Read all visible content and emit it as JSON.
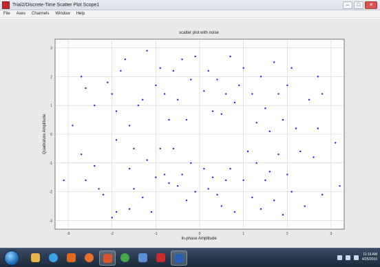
{
  "window": {
    "title": "Trial2/Discrete-Time Scatter Plot Scope1",
    "controls": {
      "minimize": "–",
      "maximize": "□",
      "close": "✕"
    }
  },
  "menu": [
    "File",
    "Axes",
    "Channels",
    "Window",
    "Help"
  ],
  "colors": {
    "marker": "#2020e0",
    "axes_background": "#ffffff",
    "figure_background": "#e9e9e9",
    "taskbar": "#1f2a3b"
  },
  "taskbar": {
    "apps": [
      {
        "name": "start-orb"
      },
      {
        "name": "file-explorer-icon",
        "color": "#e6b64a"
      },
      {
        "name": "internet-explorer-icon",
        "color": "#3aa3e6"
      },
      {
        "name": "media-player-icon",
        "color": "#e06a1f"
      },
      {
        "name": "firefox-icon",
        "color": "#e8702a"
      },
      {
        "name": "matlab-icon",
        "color": "#d9532c"
      },
      {
        "name": "chrome-icon",
        "color": "#47a64a"
      },
      {
        "name": "settings-icon",
        "color": "#5a8fd1"
      },
      {
        "name": "pdf-reader-icon",
        "color": "#cc2a2a"
      },
      {
        "name": "word-icon",
        "color": "#2b5fb4"
      }
    ],
    "clock": {
      "time": "11:19 AM",
      "date": "4/25/2016"
    }
  },
  "chart_data": {
    "type": "scatter",
    "title": "scatter plot with noise",
    "xlabel": "In-phase Amplitude",
    "ylabel": "Quadrature Amplitude",
    "xlim": [
      -3.3,
      3.3
    ],
    "ylim": [
      -3.3,
      3.3
    ],
    "xticks": [
      -3,
      -2,
      -1,
      0,
      1,
      2,
      3
    ],
    "yticks": [
      -3,
      -2,
      -1,
      0,
      1,
      2,
      3
    ],
    "grid": true,
    "marker_color": "#2020e0",
    "series": [
      {
        "points": [
          [
            -2.9,
            0.3
          ],
          [
            -2.7,
            2.0
          ],
          [
            -2.6,
            1.6
          ],
          [
            -2.4,
            1.0
          ],
          [
            -2.7,
            -0.7
          ],
          [
            -2.6,
            -1.6
          ],
          [
            -2.4,
            -1.1
          ],
          [
            -2.3,
            -1.9
          ],
          [
            -2.2,
            -2.1
          ],
          [
            -2.1,
            1.8
          ],
          [
            -2.0,
            1.4
          ],
          [
            -1.9,
            0.8
          ],
          [
            -1.9,
            -0.2
          ],
          [
            -1.9,
            -2.7
          ],
          [
            -2.0,
            -2.9
          ],
          [
            -1.8,
            2.2
          ],
          [
            -1.7,
            2.6
          ],
          [
            -1.6,
            0.3
          ],
          [
            -1.6,
            -1.2
          ],
          [
            -1.6,
            -2.6
          ],
          [
            -1.5,
            -1.9
          ],
          [
            -1.4,
            1.0
          ],
          [
            -1.5,
            -0.5
          ],
          [
            -1.3,
            1.2
          ],
          [
            -1.3,
            -2.2
          ],
          [
            -1.2,
            2.9
          ],
          [
            -1.2,
            -0.9
          ],
          [
            -1.1,
            -2.7
          ],
          [
            -1.0,
            -1.5
          ],
          [
            -1.0,
            1.7
          ],
          [
            -0.9,
            -0.5
          ],
          [
            -0.9,
            2.3
          ],
          [
            -0.8,
            -1.4
          ],
          [
            -0.8,
            1.4
          ],
          [
            -0.7,
            0.5
          ],
          [
            -0.7,
            -1.7
          ],
          [
            -0.6,
            -0.5
          ],
          [
            -0.6,
            2.2
          ],
          [
            -0.5,
            1.2
          ],
          [
            -0.5,
            -1.8
          ],
          [
            -0.4,
            2.6
          ],
          [
            -0.4,
            -1.4
          ],
          [
            -0.3,
            0.5
          ],
          [
            -0.3,
            -2.3
          ],
          [
            -0.2,
            1.9
          ],
          [
            -0.2,
            -1.0
          ],
          [
            -0.1,
            2.7
          ],
          [
            -0.1,
            -2.0
          ],
          [
            0.1,
            1.5
          ],
          [
            0.1,
            -1.2
          ],
          [
            0.2,
            2.2
          ],
          [
            0.2,
            -1.9
          ],
          [
            0.3,
            0.8
          ],
          [
            0.3,
            -1.5
          ],
          [
            0.4,
            1.9
          ],
          [
            0.4,
            -2.1
          ],
          [
            0.5,
            0.7
          ],
          [
            0.5,
            -2.5
          ],
          [
            0.6,
            1.4
          ],
          [
            0.6,
            -1.6
          ],
          [
            0.7,
            2.7
          ],
          [
            0.7,
            -1.2
          ],
          [
            0.8,
            1.1
          ],
          [
            0.8,
            -2.7
          ],
          [
            0.9,
            1.7
          ],
          [
            1.0,
            -1.6
          ],
          [
            1.0,
            2.3
          ],
          [
            1.1,
            -0.6
          ],
          [
            1.2,
            1.4
          ],
          [
            1.2,
            -2.2
          ],
          [
            1.3,
            0.4
          ],
          [
            1.3,
            -1.0
          ],
          [
            1.4,
            2.0
          ],
          [
            1.4,
            -2.6
          ],
          [
            1.5,
            0.9
          ],
          [
            1.5,
            -1.6
          ],
          [
            1.6,
            0.1
          ],
          [
            1.6,
            -1.3
          ],
          [
            1.7,
            2.5
          ],
          [
            1.7,
            -2.3
          ],
          [
            1.8,
            1.4
          ],
          [
            1.8,
            -0.7
          ],
          [
            1.9,
            0.5
          ],
          [
            1.9,
            -2.8
          ],
          [
            2.0,
            1.7
          ],
          [
            2.0,
            -1.4
          ],
          [
            2.1,
            2.3
          ],
          [
            2.1,
            -2.0
          ],
          [
            2.2,
            0.2
          ],
          [
            2.3,
            -0.6
          ],
          [
            2.4,
            -2.5
          ],
          [
            2.5,
            1.2
          ],
          [
            2.6,
            -0.8
          ],
          [
            2.7,
            2.0
          ],
          [
            2.7,
            0.2
          ],
          [
            2.8,
            1.4
          ],
          [
            2.8,
            -2.1
          ],
          [
            3.1,
            -0.3
          ],
          [
            3.2,
            -1.8
          ],
          [
            -3.1,
            -1.6
          ]
        ]
      }
    ]
  }
}
